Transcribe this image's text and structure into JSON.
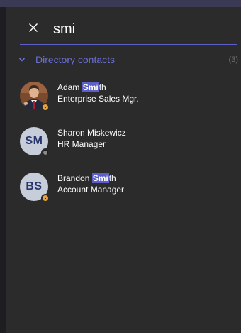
{
  "search": {
    "value": "smi",
    "close_icon": "close-icon"
  },
  "directory": {
    "title": "Directory contacts",
    "count": "(3)",
    "chevron_icon": "chevron-down-icon"
  },
  "contacts": [
    {
      "name_before": "Adam ",
      "name_match": "Smi",
      "name_after": "th",
      "title": "Enterprise Sales Mgr.",
      "avatar": "photo",
      "presence": "away"
    },
    {
      "name_before": "Sharon Miskewicz",
      "name_match": "",
      "name_after": "",
      "title": "HR Manager",
      "initials": "SM",
      "presence": "offline"
    },
    {
      "name_before": "Brandon ",
      "name_match": "Smi",
      "name_after": "th",
      "title": "Account Manager",
      "initials": "BS",
      "presence": "away"
    }
  ],
  "colors": {
    "accent": "#5b5fc7",
    "section_title": "#6b6fd4",
    "away": "#e8a33c",
    "initials_bg": "#c7ced9",
    "initials_fg": "#27356e"
  }
}
